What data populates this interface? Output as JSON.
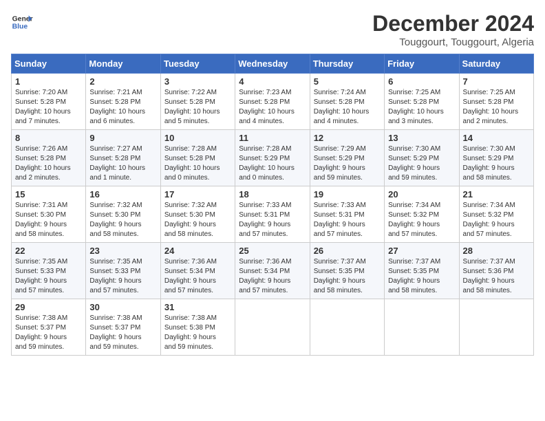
{
  "header": {
    "logo_line1": "General",
    "logo_line2": "Blue",
    "month": "December 2024",
    "location": "Touggourt, Touggourt, Algeria"
  },
  "weekdays": [
    "Sunday",
    "Monday",
    "Tuesday",
    "Wednesday",
    "Thursday",
    "Friday",
    "Saturday"
  ],
  "weeks": [
    [
      {
        "day": "1",
        "info": "Sunrise: 7:20 AM\nSunset: 5:28 PM\nDaylight: 10 hours\nand 7 minutes."
      },
      {
        "day": "2",
        "info": "Sunrise: 7:21 AM\nSunset: 5:28 PM\nDaylight: 10 hours\nand 6 minutes."
      },
      {
        "day": "3",
        "info": "Sunrise: 7:22 AM\nSunset: 5:28 PM\nDaylight: 10 hours\nand 5 minutes."
      },
      {
        "day": "4",
        "info": "Sunrise: 7:23 AM\nSunset: 5:28 PM\nDaylight: 10 hours\nand 4 minutes."
      },
      {
        "day": "5",
        "info": "Sunrise: 7:24 AM\nSunset: 5:28 PM\nDaylight: 10 hours\nand 4 minutes."
      },
      {
        "day": "6",
        "info": "Sunrise: 7:25 AM\nSunset: 5:28 PM\nDaylight: 10 hours\nand 3 minutes."
      },
      {
        "day": "7",
        "info": "Sunrise: 7:25 AM\nSunset: 5:28 PM\nDaylight: 10 hours\nand 2 minutes."
      }
    ],
    [
      {
        "day": "8",
        "info": "Sunrise: 7:26 AM\nSunset: 5:28 PM\nDaylight: 10 hours\nand 2 minutes."
      },
      {
        "day": "9",
        "info": "Sunrise: 7:27 AM\nSunset: 5:28 PM\nDaylight: 10 hours\nand 1 minute."
      },
      {
        "day": "10",
        "info": "Sunrise: 7:28 AM\nSunset: 5:28 PM\nDaylight: 10 hours\nand 0 minutes."
      },
      {
        "day": "11",
        "info": "Sunrise: 7:28 AM\nSunset: 5:29 PM\nDaylight: 10 hours\nand 0 minutes."
      },
      {
        "day": "12",
        "info": "Sunrise: 7:29 AM\nSunset: 5:29 PM\nDaylight: 9 hours\nand 59 minutes."
      },
      {
        "day": "13",
        "info": "Sunrise: 7:30 AM\nSunset: 5:29 PM\nDaylight: 9 hours\nand 59 minutes."
      },
      {
        "day": "14",
        "info": "Sunrise: 7:30 AM\nSunset: 5:29 PM\nDaylight: 9 hours\nand 58 minutes."
      }
    ],
    [
      {
        "day": "15",
        "info": "Sunrise: 7:31 AM\nSunset: 5:30 PM\nDaylight: 9 hours\nand 58 minutes."
      },
      {
        "day": "16",
        "info": "Sunrise: 7:32 AM\nSunset: 5:30 PM\nDaylight: 9 hours\nand 58 minutes."
      },
      {
        "day": "17",
        "info": "Sunrise: 7:32 AM\nSunset: 5:30 PM\nDaylight: 9 hours\nand 58 minutes."
      },
      {
        "day": "18",
        "info": "Sunrise: 7:33 AM\nSunset: 5:31 PM\nDaylight: 9 hours\nand 57 minutes."
      },
      {
        "day": "19",
        "info": "Sunrise: 7:33 AM\nSunset: 5:31 PM\nDaylight: 9 hours\nand 57 minutes."
      },
      {
        "day": "20",
        "info": "Sunrise: 7:34 AM\nSunset: 5:32 PM\nDaylight: 9 hours\nand 57 minutes."
      },
      {
        "day": "21",
        "info": "Sunrise: 7:34 AM\nSunset: 5:32 PM\nDaylight: 9 hours\nand 57 minutes."
      }
    ],
    [
      {
        "day": "22",
        "info": "Sunrise: 7:35 AM\nSunset: 5:33 PM\nDaylight: 9 hours\nand 57 minutes."
      },
      {
        "day": "23",
        "info": "Sunrise: 7:35 AM\nSunset: 5:33 PM\nDaylight: 9 hours\nand 57 minutes."
      },
      {
        "day": "24",
        "info": "Sunrise: 7:36 AM\nSunset: 5:34 PM\nDaylight: 9 hours\nand 57 minutes."
      },
      {
        "day": "25",
        "info": "Sunrise: 7:36 AM\nSunset: 5:34 PM\nDaylight: 9 hours\nand 57 minutes."
      },
      {
        "day": "26",
        "info": "Sunrise: 7:37 AM\nSunset: 5:35 PM\nDaylight: 9 hours\nand 58 minutes."
      },
      {
        "day": "27",
        "info": "Sunrise: 7:37 AM\nSunset: 5:35 PM\nDaylight: 9 hours\nand 58 minutes."
      },
      {
        "day": "28",
        "info": "Sunrise: 7:37 AM\nSunset: 5:36 PM\nDaylight: 9 hours\nand 58 minutes."
      }
    ],
    [
      {
        "day": "29",
        "info": "Sunrise: 7:38 AM\nSunset: 5:37 PM\nDaylight: 9 hours\nand 59 minutes."
      },
      {
        "day": "30",
        "info": "Sunrise: 7:38 AM\nSunset: 5:37 PM\nDaylight: 9 hours\nand 59 minutes."
      },
      {
        "day": "31",
        "info": "Sunrise: 7:38 AM\nSunset: 5:38 PM\nDaylight: 9 hours\nand 59 minutes."
      },
      {
        "day": "",
        "info": ""
      },
      {
        "day": "",
        "info": ""
      },
      {
        "day": "",
        "info": ""
      },
      {
        "day": "",
        "info": ""
      }
    ]
  ]
}
